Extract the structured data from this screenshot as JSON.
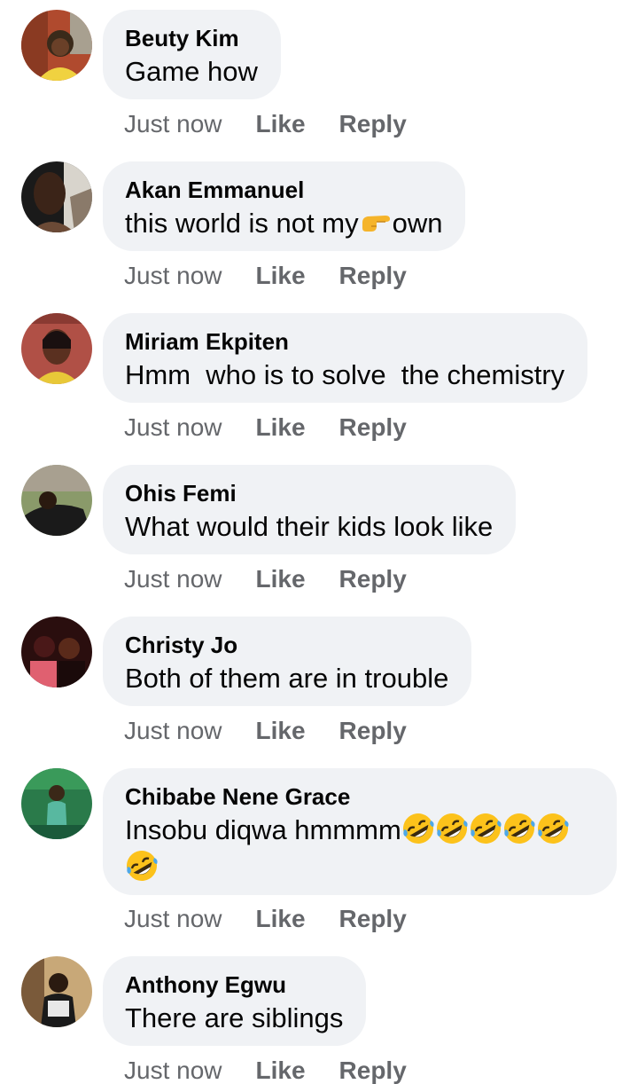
{
  "comments": [
    {
      "author": "Beuty Kim",
      "text": "Game how",
      "time": "Just now",
      "like": "Like",
      "reply": "Reply",
      "avatar_colors": [
        "#b04a2e",
        "#f0d240",
        "#3a2a1a"
      ]
    },
    {
      "author": "Akan Emmanuel",
      "text_before": "this world is not my",
      "emoji": "backhand-index-pointing-right",
      "text_after": "own",
      "time": "Just now",
      "like": "Like",
      "reply": "Reply",
      "avatar_colors": [
        "#3b2418",
        "#6b4a36",
        "#d8d4cc"
      ]
    },
    {
      "author": "Miriam Ekpiten",
      "text": "Hmm  who is to solve  the chemistry",
      "time": "Just now",
      "like": "Like",
      "reply": "Reply",
      "avatar_colors": [
        "#b05046",
        "#5a3020",
        "#e8c838"
      ]
    },
    {
      "author": "Ohis Femi",
      "text": "What would their kids look like",
      "time": "Just now",
      "like": "Like",
      "reply": "Reply",
      "avatar_colors": [
        "#8a9a6a",
        "#1a1a1a",
        "#a8a090"
      ]
    },
    {
      "author": "Christy Jo",
      "text": "Both of them are in trouble",
      "time": "Just now",
      "like": "Like",
      "reply": "Reply",
      "avatar_colors": [
        "#4a1818",
        "#e06070",
        "#2a0e0e"
      ]
    },
    {
      "author": "Chibabe Nene Grace",
      "text": "Insobu diqwa hmmmm",
      "emoji": "rolling-on-the-floor-laughing",
      "emoji_count": 6,
      "time": "Just now",
      "like": "Like",
      "reply": "Reply",
      "avatar_colors": [
        "#2a7a4a",
        "#58b8a0",
        "#3a2818"
      ]
    },
    {
      "author": "Anthony Egwu",
      "text": "There are siblings",
      "time": "Just now",
      "like": "Like",
      "reply": "Reply",
      "avatar_colors": [
        "#7a5a3a",
        "#1a1a1a",
        "#c8a878"
      ]
    }
  ]
}
